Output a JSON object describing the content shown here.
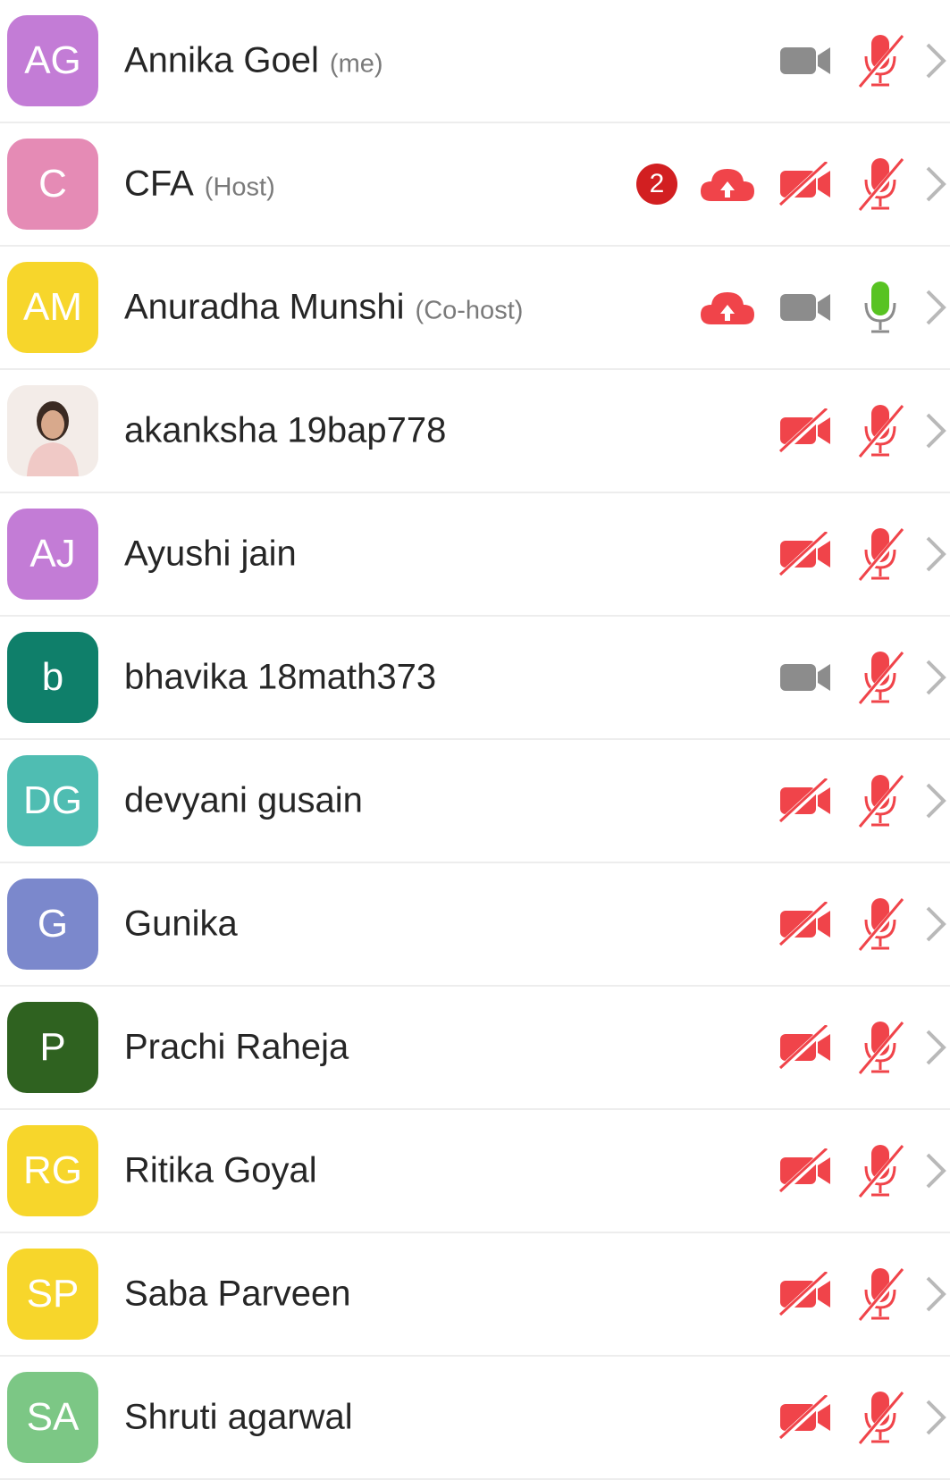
{
  "participants": [
    {
      "initials": "AG",
      "color": "#c37cd6",
      "name": "Annika Goel",
      "tag": "(me)",
      "badge": null,
      "cloud": false,
      "video": "on",
      "mic": "muted"
    },
    {
      "initials": "C",
      "color": "#e58bb5",
      "name": "CFA",
      "tag": "(Host)",
      "badge": "2",
      "cloud": true,
      "video": "off",
      "mic": "muted"
    },
    {
      "initials": "AM",
      "color": "#f7d62b",
      "name": "Anuradha Munshi",
      "tag": "(Co-host)",
      "badge": null,
      "cloud": true,
      "video": "on",
      "mic": "active"
    },
    {
      "initials": "",
      "color": "#f3ece8",
      "photo": true,
      "name": "akanksha 19bap778",
      "tag": "",
      "badge": null,
      "cloud": false,
      "video": "off",
      "mic": "muted"
    },
    {
      "initials": "AJ",
      "color": "#c37cd6",
      "name": "Ayushi jain",
      "tag": "",
      "badge": null,
      "cloud": false,
      "video": "off",
      "mic": "muted"
    },
    {
      "initials": "b",
      "color": "#0f7f6a",
      "name": "bhavika 18math373",
      "tag": "",
      "badge": null,
      "cloud": false,
      "video": "on",
      "mic": "muted"
    },
    {
      "initials": "DG",
      "color": "#4fbdb2",
      "name": "devyani gusain",
      "tag": "",
      "badge": null,
      "cloud": false,
      "video": "off",
      "mic": "muted"
    },
    {
      "initials": "G",
      "color": "#7b88cc",
      "name": "Gunika",
      "tag": "",
      "badge": null,
      "cloud": false,
      "video": "off",
      "mic": "muted"
    },
    {
      "initials": "P",
      "color": "#2f6220",
      "name": "Prachi Raheja",
      "tag": "",
      "badge": null,
      "cloud": false,
      "video": "off",
      "mic": "muted"
    },
    {
      "initials": "RG",
      "color": "#f7d62b",
      "name": "Ritika Goyal",
      "tag": "",
      "badge": null,
      "cloud": false,
      "video": "off",
      "mic": "muted"
    },
    {
      "initials": "SP",
      "color": "#f7d62b",
      "name": "Saba Parveen",
      "tag": "",
      "badge": null,
      "cloud": false,
      "video": "off",
      "mic": "muted"
    },
    {
      "initials": "SA",
      "color": "#7cc785",
      "name": "Shruti agarwal",
      "tag": "",
      "badge": null,
      "cloud": false,
      "video": "off",
      "mic": "muted"
    }
  ],
  "colors": {
    "red": "#f0444a",
    "gray": "#8c8c8c",
    "green": "#58c322",
    "chevron": "#b9b9b9"
  }
}
